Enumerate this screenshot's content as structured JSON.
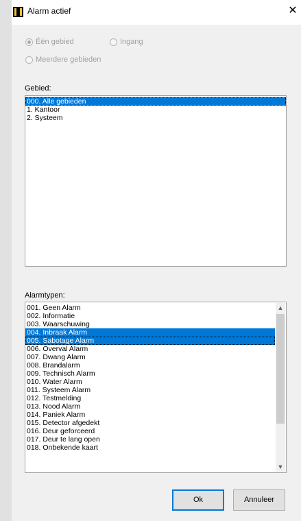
{
  "window": {
    "title": "Alarm actief",
    "close_icon": "close-icon",
    "app_icon": "app-icon"
  },
  "scope": {
    "options": [
      {
        "label": "Één gebied",
        "selected": true
      },
      {
        "label": "Ingang",
        "selected": false
      },
      {
        "label": "Meerdere gebieden",
        "selected": false
      }
    ]
  },
  "areas": {
    "label": "Gebied:",
    "items": [
      {
        "text": "000. Alle gebieden",
        "selected": true
      },
      {
        "text": "1. Kantoor",
        "selected": false
      },
      {
        "text": "2. Systeem",
        "selected": false
      }
    ]
  },
  "alarm_types": {
    "label": "Alarmtypen:",
    "items": [
      {
        "text": "001. Geen Alarm",
        "selected": false
      },
      {
        "text": "002. Informatie",
        "selected": false
      },
      {
        "text": "003. Waarschuwing",
        "selected": false
      },
      {
        "text": "004. Inbraak Alarm",
        "selected": true
      },
      {
        "text": "005. Sabotage Alarm",
        "selected": true
      },
      {
        "text": "006. Overval Alarm",
        "selected": false
      },
      {
        "text": "007. Dwang Alarm",
        "selected": false
      },
      {
        "text": "008. Brandalarm",
        "selected": false
      },
      {
        "text": "009. Technisch Alarm",
        "selected": false
      },
      {
        "text": "010. Water Alarm",
        "selected": false
      },
      {
        "text": "011. Systeem Alarm",
        "selected": false
      },
      {
        "text": "012. Testmelding",
        "selected": false
      },
      {
        "text": "013. Nood Alarm",
        "selected": false
      },
      {
        "text": "014. Paniek Alarm",
        "selected": false
      },
      {
        "text": "015. Detector afgedekt",
        "selected": false
      },
      {
        "text": "016. Deur geforceerd",
        "selected": false
      },
      {
        "text": "017. Deur te lang open",
        "selected": false
      },
      {
        "text": "018. Onbekende kaart",
        "selected": false
      }
    ]
  },
  "buttons": {
    "ok": "Ok",
    "cancel": "Annuleer"
  },
  "colors": {
    "selection": "#0078d7",
    "background": "#f0f0f0"
  }
}
